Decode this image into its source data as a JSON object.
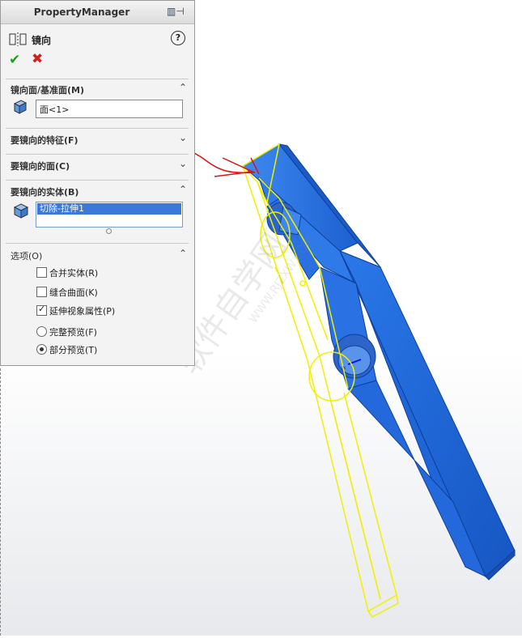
{
  "panel": {
    "title": "PropertyManager",
    "feature_name": "镜向",
    "sections": {
      "mirror_face": "镜向面/基准面(M)",
      "features": "要镜向的特征(F)",
      "faces": "要镜向的面(C)",
      "bodies": "要镜向的实体(B)",
      "options": "选项(O)"
    },
    "mirror_face_value": "面<1>",
    "body_item": "切除-拉伸1",
    "options": {
      "merge": "合并实体(R)",
      "knit": "缝合曲面(K)",
      "propagate": "延伸视象属性(P)",
      "full_preview": "完整预览(F)",
      "partial_preview": "部分预览(T)"
    }
  },
  "watermark": "软件自学网",
  "watermark_url": "WWW.RJZXW.COM",
  "colors": {
    "model_blue": "#1e6fe0",
    "preview_yellow": "#f4f400",
    "annotation_red": "#e01010"
  }
}
